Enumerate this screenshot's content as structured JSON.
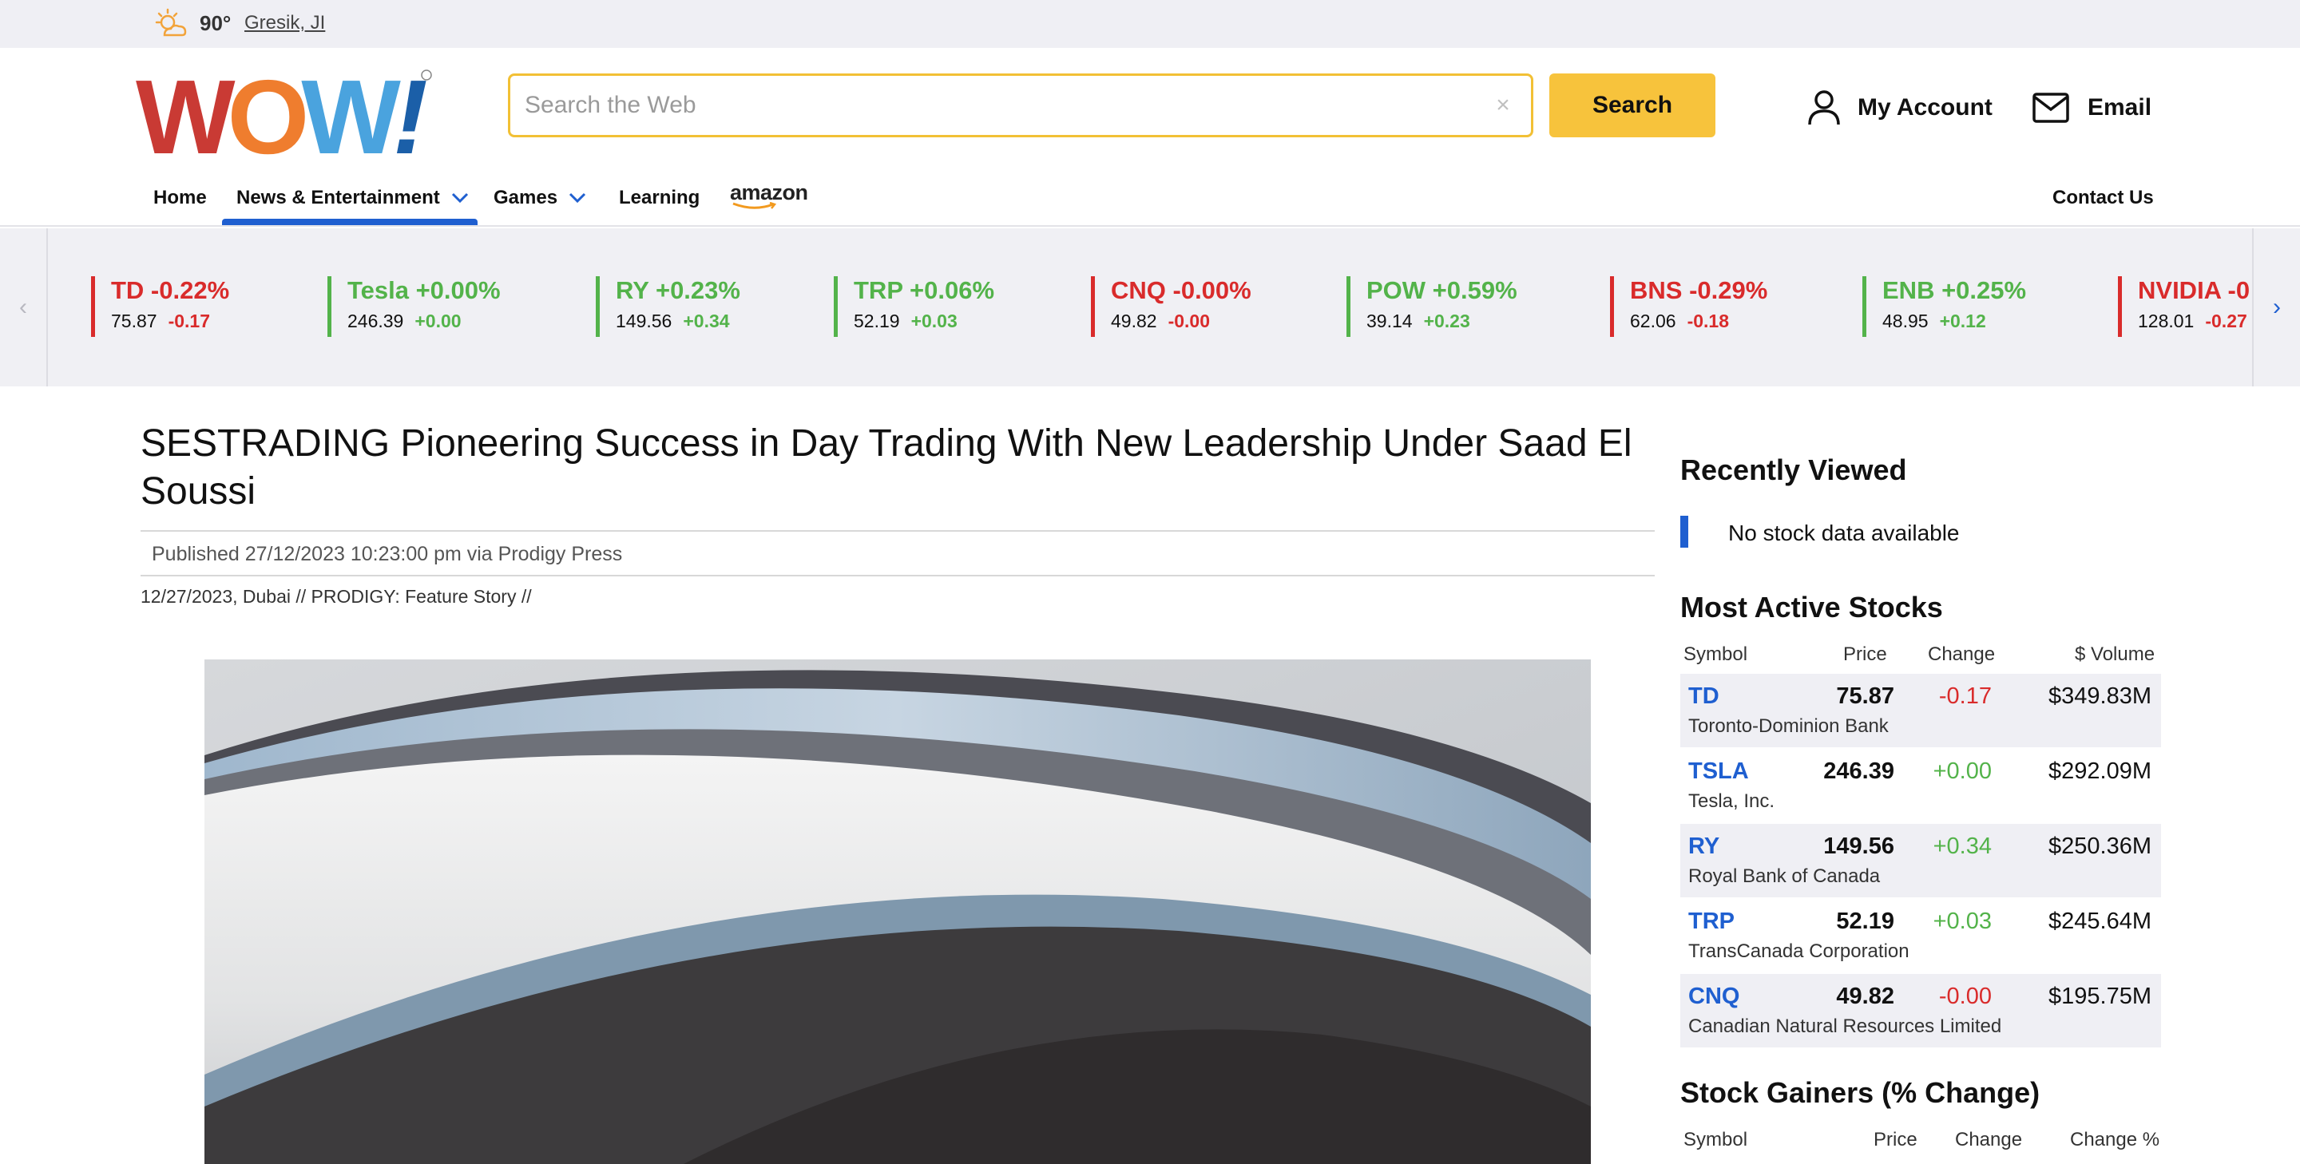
{
  "weather": {
    "icon": "partly-sunny-icon",
    "temperature": "90°",
    "location": "Gresik, JI"
  },
  "header": {
    "logo_text": "WOW!",
    "search": {
      "placeholder": "Search the Web",
      "value": "",
      "button_label": "Search"
    },
    "account_label": "My Account",
    "email_label": "Email"
  },
  "nav": {
    "items": [
      {
        "label": "Home"
      },
      {
        "label": "News & Entertainment",
        "has_dropdown": true,
        "active": true
      },
      {
        "label": "Games",
        "has_dropdown": true
      },
      {
        "label": "Learning"
      },
      {
        "label": "amazon",
        "icon": "amazon-logo"
      }
    ],
    "contact": "Contact Us"
  },
  "ticker": [
    {
      "head": "TD -0.22%",
      "price": "75.87",
      "change": "-0.17",
      "up": false
    },
    {
      "head": "Tesla +0.00%",
      "price": "246.39",
      "change": "+0.00",
      "up": true
    },
    {
      "head": "RY +0.23%",
      "price": "149.56",
      "change": "+0.34",
      "up": true
    },
    {
      "head": "TRP +0.06%",
      "price": "52.19",
      "change": "+0.03",
      "up": true
    },
    {
      "head": "CNQ -0.00%",
      "price": "49.82",
      "change": "-0.00",
      "up": false
    },
    {
      "head": "POW +0.59%",
      "price": "39.14",
      "change": "+0.23",
      "up": true
    },
    {
      "head": "BNS -0.29%",
      "price": "62.06",
      "change": "-0.18",
      "up": false
    },
    {
      "head": "ENB +0.25%",
      "price": "48.95",
      "change": "+0.12",
      "up": true
    },
    {
      "head": "NVIDIA -0",
      "price": "128.01",
      "change": "-0.27",
      "up": false
    }
  ],
  "article": {
    "title": "SESTRADING Pioneering Success in Day Trading With New Leadership Under Saad El Soussi",
    "meta": "Published 27/12/2023 10:23:00 pm via Prodigy Press",
    "dateline": "12/27/2023, Dubai // PRODIGY: Feature Story //"
  },
  "sidebar": {
    "recently_viewed": {
      "title": "Recently Viewed",
      "empty_text": "No stock data available"
    },
    "most_active": {
      "title": "Most Active Stocks",
      "columns": [
        "Symbol",
        "Price",
        "Change",
        "$ Volume"
      ],
      "rows": [
        {
          "symbol": "TD",
          "name": "Toronto-Dominion Bank",
          "price": "75.87",
          "change": "-0.17",
          "up": false,
          "volume": "$349.83M"
        },
        {
          "symbol": "TSLA",
          "name": "Tesla, Inc.",
          "price": "246.39",
          "change": "+0.00",
          "up": true,
          "volume": "$292.09M"
        },
        {
          "symbol": "RY",
          "name": "Royal Bank of Canada",
          "price": "149.56",
          "change": "+0.34",
          "up": true,
          "volume": "$250.36M"
        },
        {
          "symbol": "TRP",
          "name": "TransCanada Corporation",
          "price": "52.19",
          "change": "+0.03",
          "up": true,
          "volume": "$245.64M"
        },
        {
          "symbol": "CNQ",
          "name": "Canadian Natural Resources Limited",
          "price": "49.82",
          "change": "-0.00",
          "up": false,
          "volume": "$195.75M"
        }
      ]
    },
    "gainers": {
      "title": "Stock Gainers (% Change)",
      "columns": [
        "Symbol",
        "Price",
        "Change",
        "Change %"
      ]
    }
  },
  "colors": {
    "brand_blue": "#1f5fd0",
    "search_accent": "#f7c33c",
    "negative": "#d92b2b",
    "positive": "#53b34a"
  }
}
